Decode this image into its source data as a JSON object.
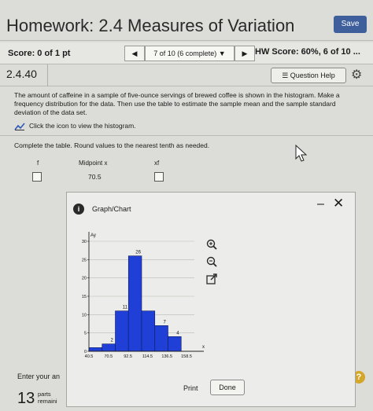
{
  "header": {
    "title": "Homework: 2.4 Measures of Variation",
    "save_label": "Save"
  },
  "score_bar": {
    "score": "Score: 0 of 1 pt",
    "prev_icon": "◀",
    "pager": "7 of 10 (6 complete) ▼",
    "next_icon": "▶",
    "hw_score": "HW Score: 60%, 6 of 10 ..."
  },
  "question": {
    "id": "2.4.40",
    "help_label": "☰ Question Help",
    "gear_icon": "⚙",
    "text": "The amount of caffeine in a sample of five-ounce servings of brewed coffee is shown in the histogram. Make a frequency distribution for the data. Then use the table to estimate the sample mean and the sample standard deviation of the data set.",
    "histogram_link": "Click the icon to view the histogram.",
    "instruction": "Complete the table. Round values to the nearest tenth as needed."
  },
  "table": {
    "headers": [
      "f",
      "Midpoint x",
      "xf"
    ],
    "first_midpoint": "70.5"
  },
  "footer": {
    "enter_text": "Enter your an",
    "parts_count": "13",
    "parts_label_1": "parts",
    "parts_label_2": "remaini",
    "help_icon": "?"
  },
  "modal": {
    "title": "Graph/Chart",
    "info_icon": "i",
    "minimize_icon": "–",
    "close_icon": "✕",
    "print_label": "Print",
    "done_label": "Done"
  },
  "chart_data": {
    "type": "bar",
    "edges": [
      40.5,
      55.5,
      70.5,
      85.5,
      100.5,
      115.5,
      130.5,
      145.5,
      160.5
    ],
    "values": [
      1,
      2,
      11,
      26,
      11,
      7,
      4
    ],
    "value_labels": [
      "",
      "2",
      "11",
      "26",
      "",
      "7",
      "4"
    ],
    "tick_labels": [
      "40.5",
      "70.5",
      "92.5",
      "114.5",
      "136.5",
      "158.5"
    ],
    "y_ticks": [
      0,
      5,
      10,
      15,
      20,
      25,
      30
    ],
    "xlabel": "x",
    "ylabel": "Ay",
    "ylim": [
      0,
      30
    ],
    "bar_color": "#1f3fd6"
  }
}
